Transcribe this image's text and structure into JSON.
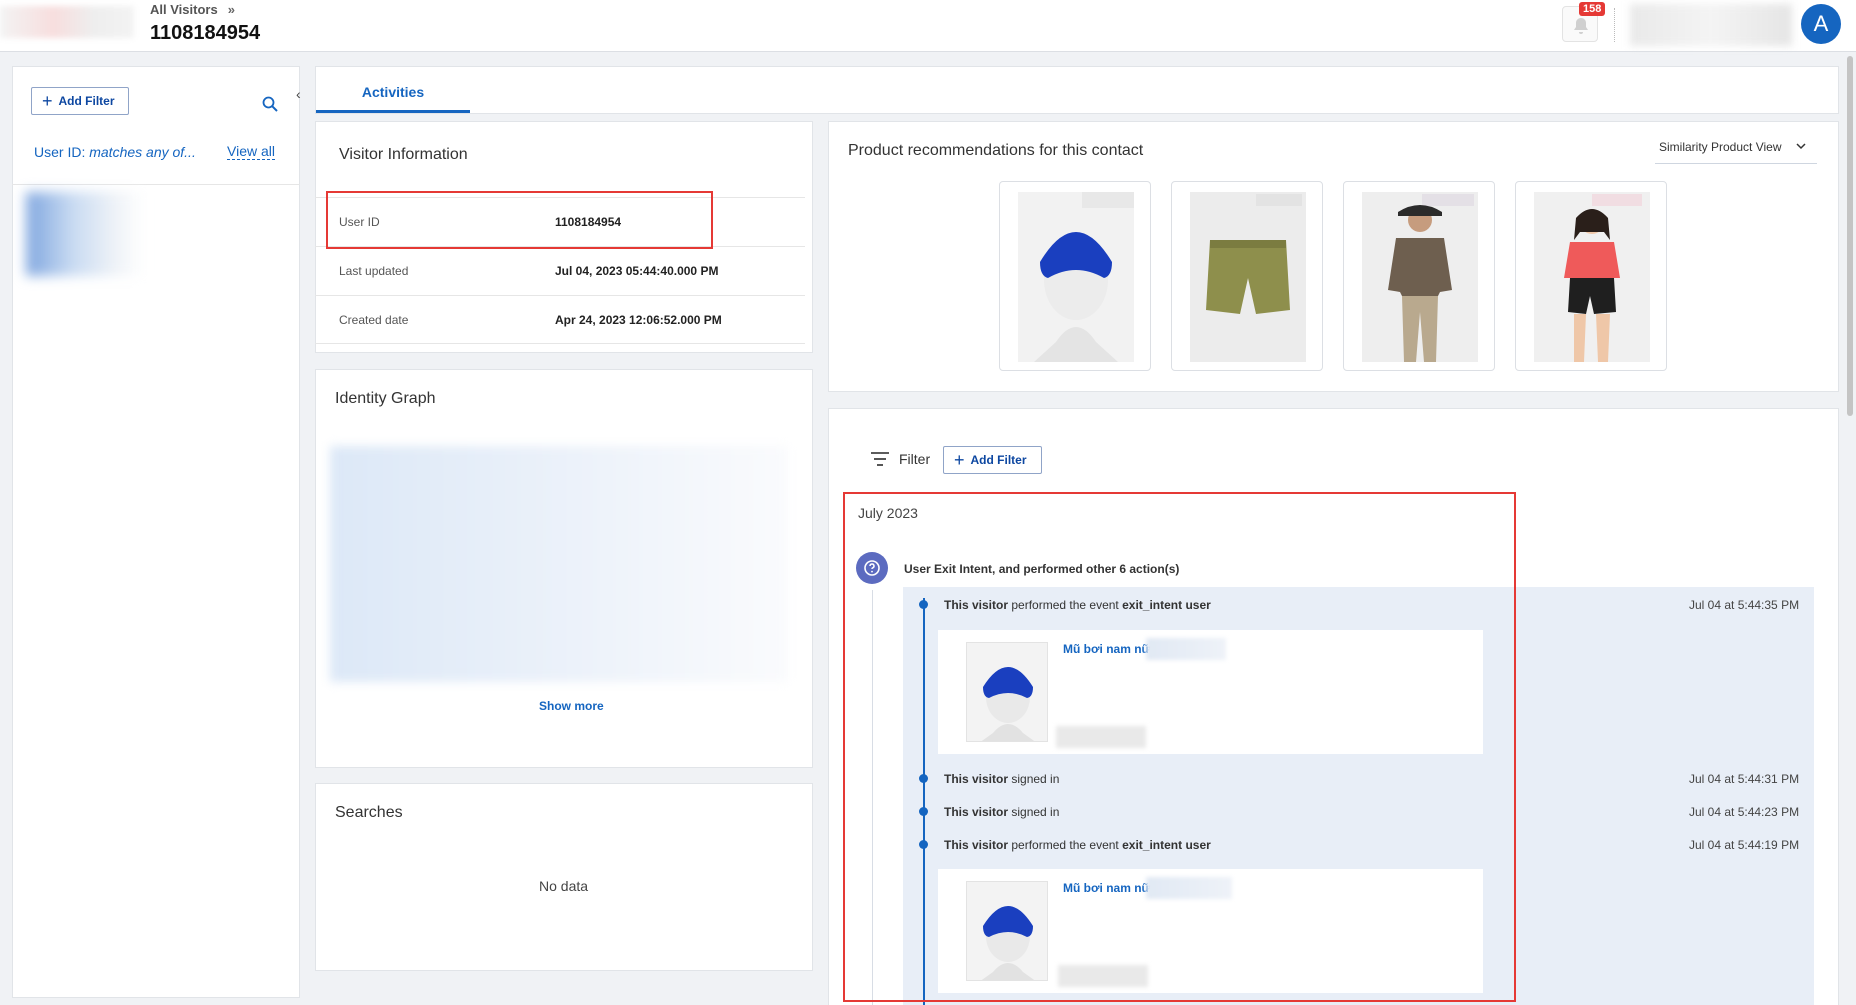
{
  "header": {
    "breadcrumb": "All Visitors",
    "breadcrumb_sep": "»",
    "title": "1108184954",
    "notification_count": "158",
    "avatar_letter": "A"
  },
  "left": {
    "add_filter": "Add Filter",
    "filter_prefix": "User ID: ",
    "filter_value": "matches any of...",
    "view_all": "View all"
  },
  "tabs": [
    {
      "label": "Activities",
      "active": true
    }
  ],
  "visitor_info": {
    "title": "Visitor Information",
    "rows": [
      {
        "key": "User ID",
        "value": "1108184954"
      },
      {
        "key": "Last updated",
        "value": "Jul 04, 2023 05:44:40.000 PM"
      },
      {
        "key": "Created date",
        "value": "Apr 24, 2023 12:06:52.000 PM"
      }
    ]
  },
  "identity_graph": {
    "title": "Identity Graph",
    "show_more": "Show more"
  },
  "searches": {
    "title": "Searches",
    "empty": "No data"
  },
  "recommendations": {
    "title": "Product recommendations for this contact",
    "dropdown": "Similarity Product View",
    "products": [
      "blue-swim-cap",
      "olive-shorts",
      "man-olive-polo",
      "woman-pink-polo"
    ]
  },
  "activity": {
    "filter_label": "Filter",
    "add_filter": "Add Filter",
    "month": "July 2023",
    "group_title": "User Exit Intent, and performed other 6 action(s)",
    "events": [
      {
        "subject": "This visitor",
        "action": " performed the event ",
        "event": "exit_intent user",
        "time": "Jul 04 at 5:44:35 PM"
      },
      {
        "subject": "This visitor",
        "action": " signed in",
        "event": "",
        "time": "Jul 04 at 5:44:31 PM"
      },
      {
        "subject": "This visitor",
        "action": " signed in",
        "event": "",
        "time": "Jul 04 at 5:44:23 PM"
      },
      {
        "subject": "This visitor",
        "action": " performed the event ",
        "event": "exit_intent user",
        "time": "Jul 04 at 5:44:19 PM"
      }
    ],
    "product_name": "Mũ bơi nam nữ"
  },
  "colors": {
    "accent": "#1565c0",
    "highlight": "#e53935",
    "badge": "#e53935"
  }
}
